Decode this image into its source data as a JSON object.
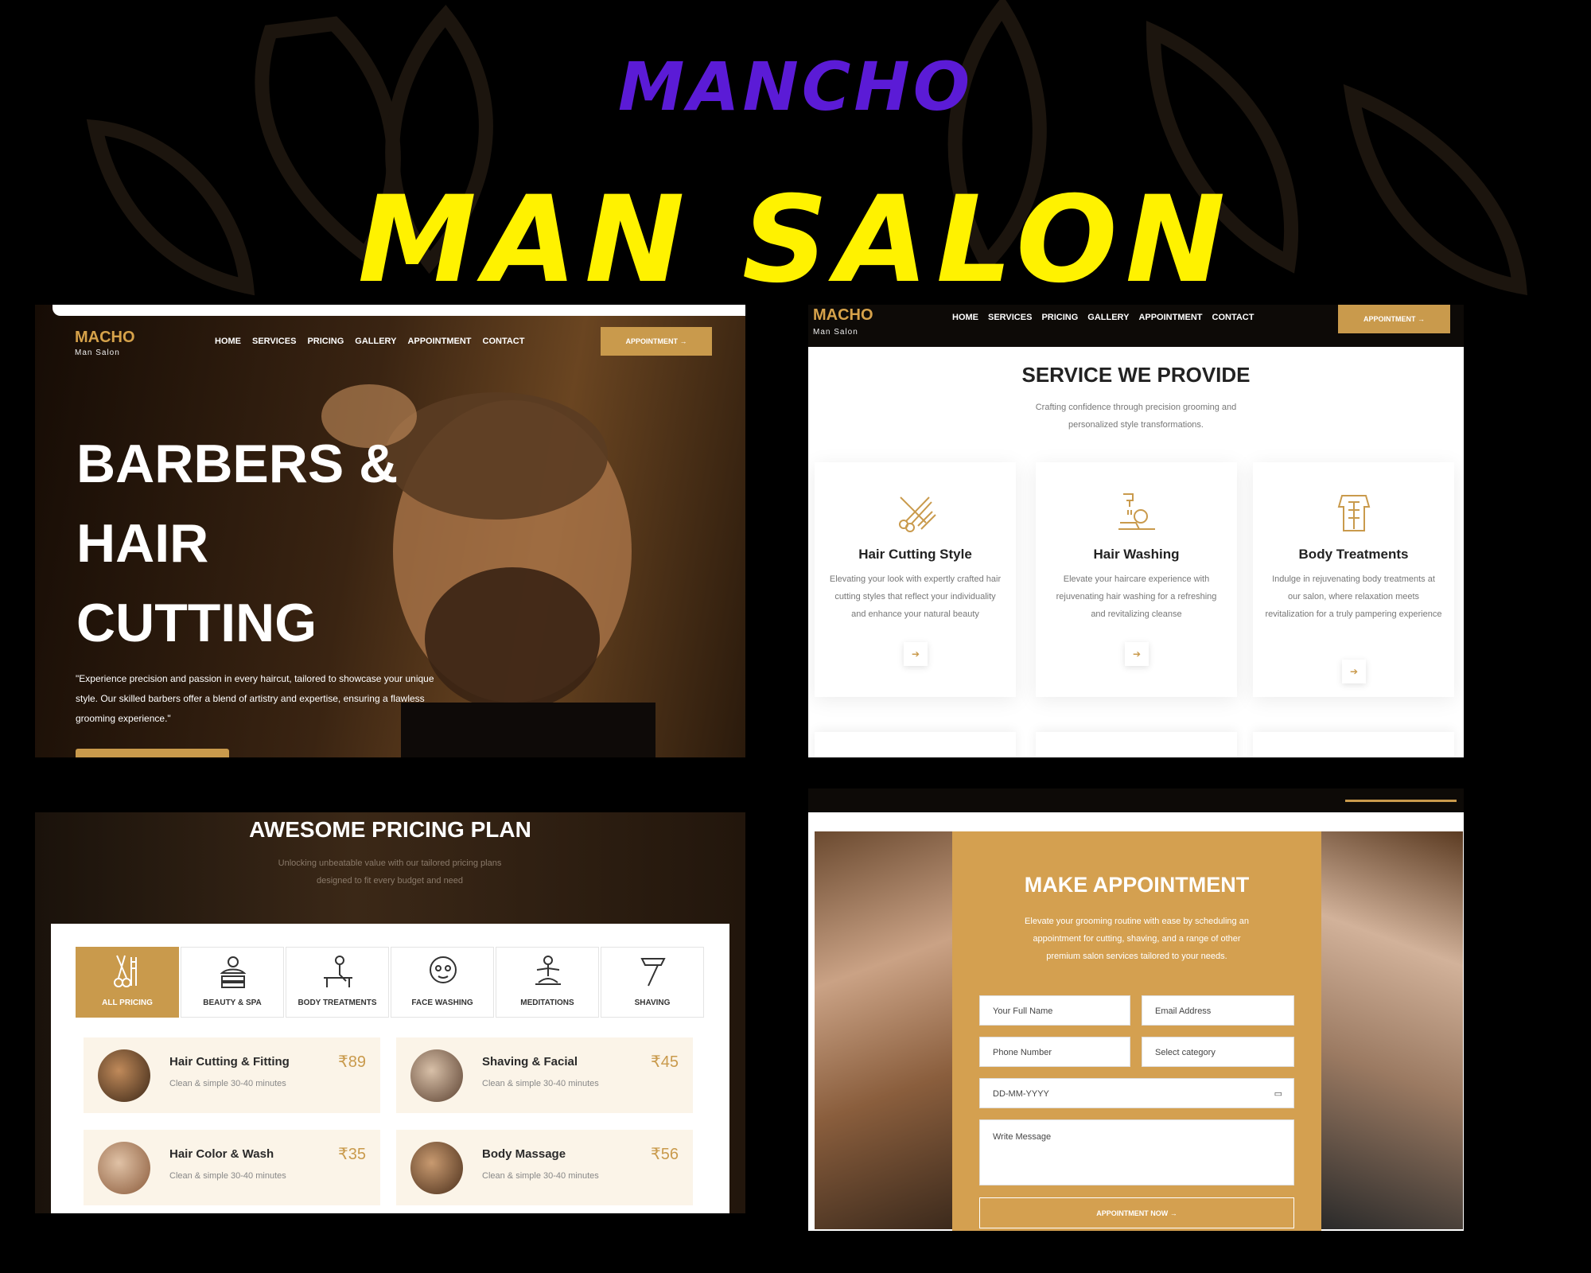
{
  "banner": {
    "brand": "MANCHO",
    "title": "MAN SALON"
  },
  "hero": {
    "logo": "MACHO",
    "logo_sub": "Man Salon",
    "nav": [
      "HOME",
      "SERVICES",
      "PRICING",
      "GALLERY",
      "APPOINTMENT",
      "CONTACT"
    ],
    "appointment_btn": "APPOINTMENT →",
    "title_line1": "BARBERS &",
    "title_line2": "HAIR",
    "title_line3": "CUTTING",
    "text": "\"Experience precision and passion in every haircut, tailored to showcase your unique style. Our skilled barbers offer a blend of artistry and expertise, ensuring a flawless grooming experience.\""
  },
  "services": {
    "logo": "MACHO",
    "logo_sub": "Man Salon",
    "nav": [
      "HOME",
      "SERVICES",
      "PRICING",
      "GALLERY",
      "APPOINTMENT",
      "CONTACT"
    ],
    "appointment_btn": "APPOINTMENT →",
    "title": "SERVICE WE PROVIDE",
    "subtitle": "Crafting confidence through precision grooming and personalized style transformations.",
    "cards": [
      {
        "icon": "scissors-comb-icon",
        "title": "Hair Cutting Style",
        "desc": "Elevating your look with expertly crafted hair cutting styles that reflect your individuality and enhance your natural beauty"
      },
      {
        "icon": "hair-washing-icon",
        "title": "Hair Washing",
        "desc": "Elevate your haircare experience with rejuvenating hair washing for a refreshing and revitalizing cleanse"
      },
      {
        "icon": "body-treatment-icon",
        "title": "Body Treatments",
        "desc": "Indulge in rejuvenating body treatments at our salon, where relaxation meets revitalization for a truly pampering experience"
      }
    ]
  },
  "pricing": {
    "title": "AWESOME PRICING PLAN",
    "subtitle": "Unlocking unbeatable value with our tailored pricing plans designed to fit every budget and need",
    "tabs": [
      {
        "label": "ALL PRICING",
        "icon": "scissors-tools-icon"
      },
      {
        "label": "BEAUTY & SPA",
        "icon": "spa-icon"
      },
      {
        "label": "BODY TREATMENTS",
        "icon": "massage-icon"
      },
      {
        "label": "FACE WASHING",
        "icon": "face-mask-icon"
      },
      {
        "label": "MEDITATIONS",
        "icon": "meditation-icon"
      },
      {
        "label": "SHAVING",
        "icon": "razor-icon"
      }
    ],
    "items": [
      {
        "name": "Hair Cutting & Fitting",
        "desc": "Clean & simple 30-40 minutes",
        "price": "₹89"
      },
      {
        "name": "Shaving & Facial",
        "desc": "Clean & simple 30-40 minutes",
        "price": "₹45"
      },
      {
        "name": "Hair Color & Wash",
        "desc": "Clean & simple 30-40 minutes",
        "price": "₹35"
      },
      {
        "name": "Body Massage",
        "desc": "Clean & simple 30-40 minutes",
        "price": "₹56"
      }
    ]
  },
  "appointment": {
    "title": "MAKE APPOINTMENT",
    "subtitle": "Elevate your grooming routine with ease by scheduling an appointment for cutting, shaving, and a range of other premium salon services tailored to your needs.",
    "full_name": "Your Full Name",
    "email": "Email Address",
    "phone": "Phone Number",
    "category": "Select category",
    "date": "DD-MM-YYYY",
    "message": "Write Message",
    "submit": "APPOINTMENT NOW →"
  },
  "colors": {
    "gold": "#c99a4c",
    "purple": "#5b1bd6",
    "yellow": "#fff200"
  }
}
